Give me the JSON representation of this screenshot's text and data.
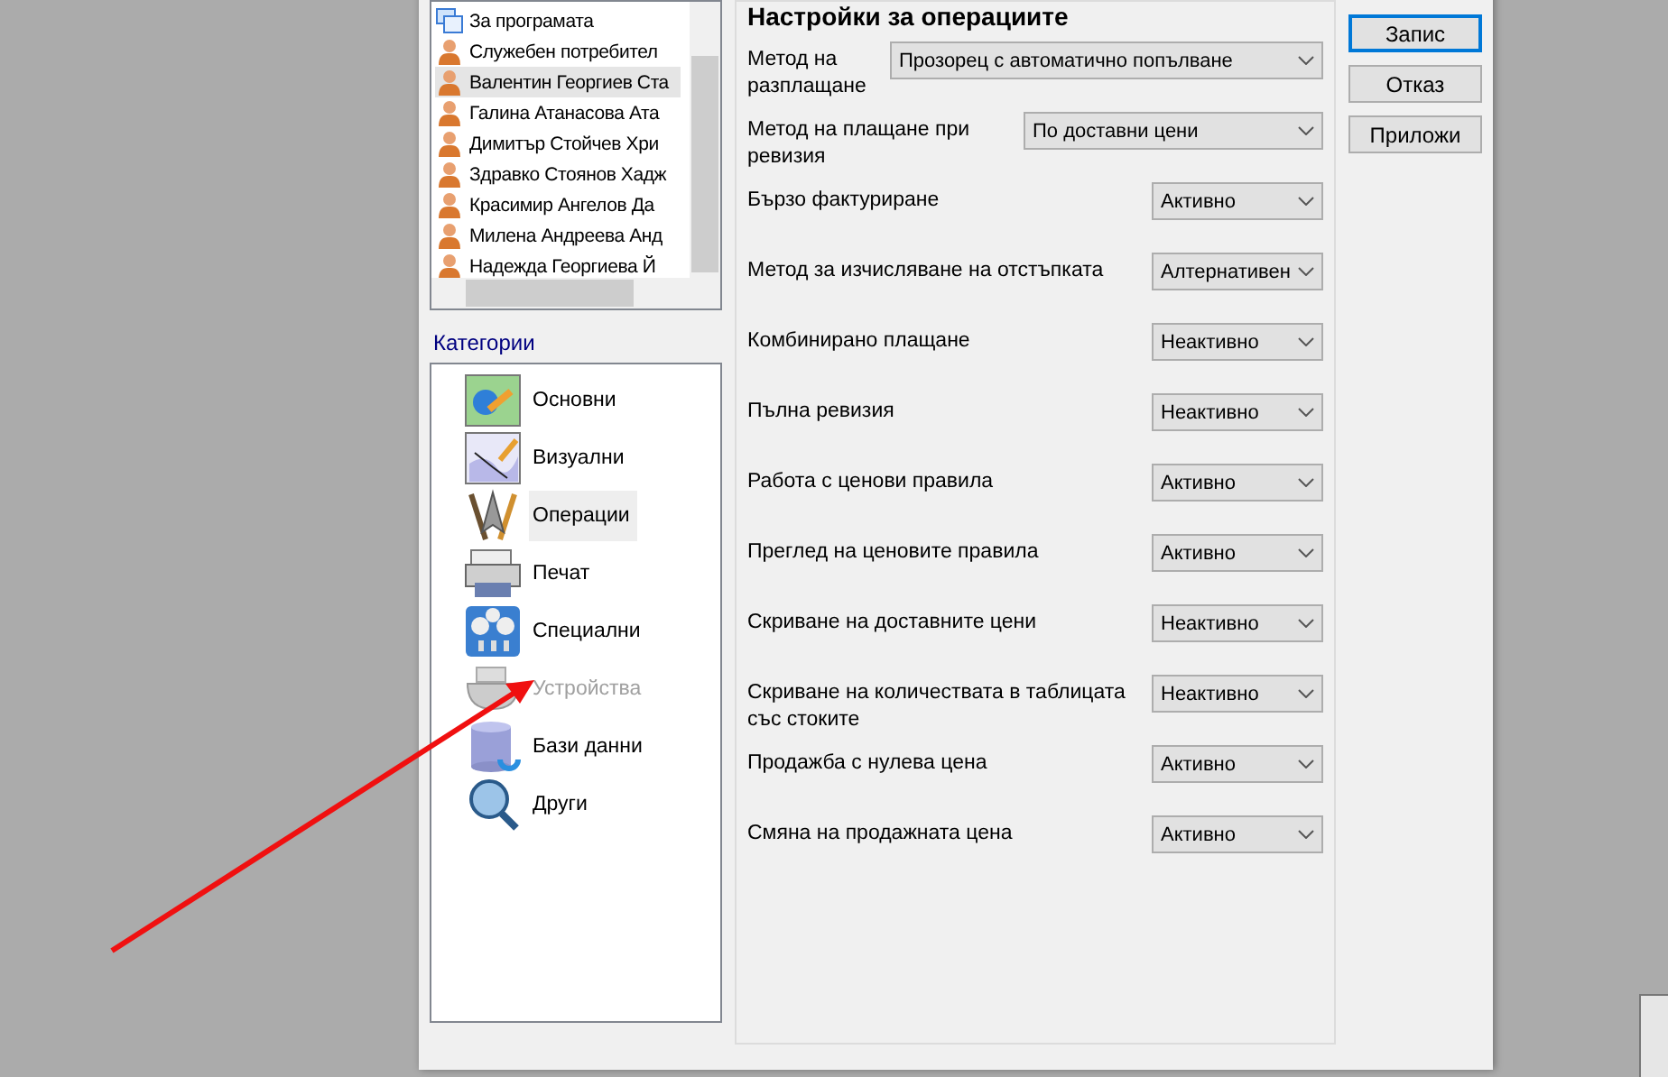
{
  "users": [
    {
      "name": "За програмата",
      "kind": "program",
      "selected": false
    },
    {
      "name": "Служебен потребител",
      "kind": "user",
      "selected": false
    },
    {
      "name": "Валентин Георгиев Ста",
      "kind": "user",
      "selected": true
    },
    {
      "name": "Галина Атанасова Ата",
      "kind": "user",
      "selected": false
    },
    {
      "name": "Димитър Стойчев Хри",
      "kind": "user",
      "selected": false
    },
    {
      "name": "Здравко Стоянов Хадж",
      "kind": "user",
      "selected": false
    },
    {
      "name": "Красимир Ангелов Да",
      "kind": "user",
      "selected": false
    },
    {
      "name": "Милена Андреева Анд",
      "kind": "user",
      "selected": false
    },
    {
      "name": "Надежда Георгиева Й",
      "kind": "user",
      "selected": false
    }
  ],
  "categories_label": "Категории",
  "categories": [
    {
      "label": "Основни",
      "kind": "basic",
      "selected": false,
      "disabled": false
    },
    {
      "label": "Визуални",
      "kind": "visual",
      "selected": false,
      "disabled": false
    },
    {
      "label": "Операции",
      "kind": "operations",
      "selected": true,
      "disabled": false
    },
    {
      "label": "Печат",
      "kind": "print",
      "selected": false,
      "disabled": false
    },
    {
      "label": "Специални",
      "kind": "special",
      "selected": false,
      "disabled": false
    },
    {
      "label": "Устройства",
      "kind": "devices",
      "selected": false,
      "disabled": true
    },
    {
      "label": "Бази данни",
      "kind": "database",
      "selected": false,
      "disabled": false
    },
    {
      "label": "Други",
      "kind": "other",
      "selected": false,
      "disabled": false
    }
  ],
  "settings": {
    "title": "Настройки за операциите",
    "rows": [
      {
        "label": "Метод на разплащане",
        "value": "Прозорец с автоматично попълване",
        "kind": "long"
      },
      {
        "label": "Метод на плащане при ревизия",
        "value": "По доставни цени",
        "kind": "medium"
      },
      {
        "label": "Бързо фактуриране",
        "value": "Активно",
        "kind": "short"
      },
      {
        "label": "Метод за изчисляване на отстъпката",
        "value": "Алтернативен",
        "kind": "short"
      },
      {
        "label": "Комбинирано плащане",
        "value": "Неактивно",
        "kind": "short"
      },
      {
        "label": "Пълна ревизия",
        "value": "Неактивно",
        "kind": "short"
      },
      {
        "label": "Работа с ценови правила",
        "value": "Активно",
        "kind": "short"
      },
      {
        "label": "Преглед на ценовите правила",
        "value": "Активно",
        "kind": "short"
      },
      {
        "label": "Скриване на доставните цени",
        "value": "Неактивно",
        "kind": "short"
      },
      {
        "label": "Скриване на количествата в таблицата със стоките",
        "value": "Неактивно",
        "kind": "short"
      },
      {
        "label": "Продажба с нулева цена",
        "value": "Активно",
        "kind": "short"
      },
      {
        "label": "Смяна на продажната цена",
        "value": "Активно",
        "kind": "short"
      }
    ]
  },
  "buttons": [
    {
      "label": "Запис",
      "default": true
    },
    {
      "label": "Отказ",
      "default": false
    },
    {
      "label": "Приложи",
      "default": false
    }
  ]
}
